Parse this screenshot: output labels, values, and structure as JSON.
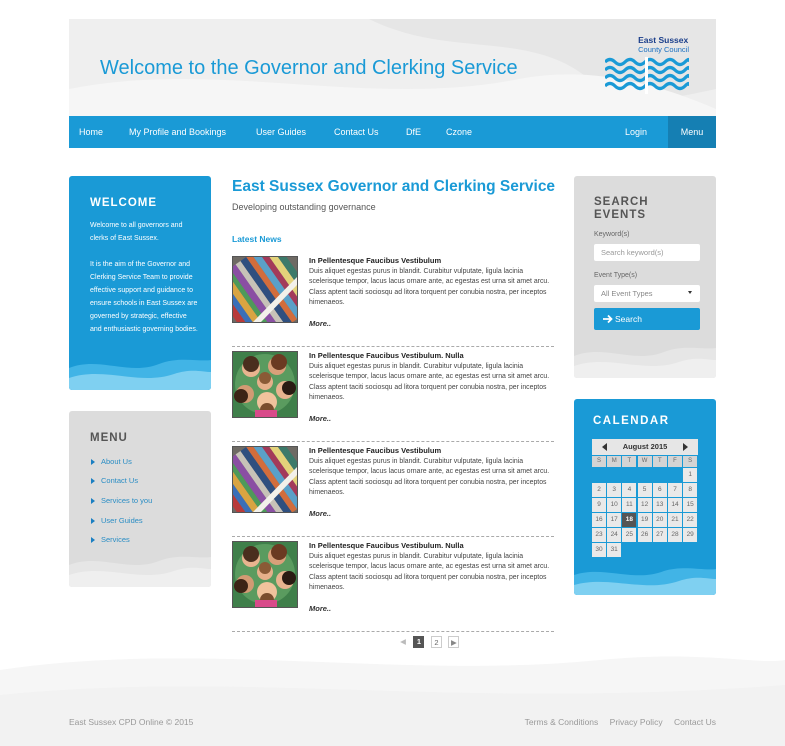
{
  "header": {
    "title": "Welcome to the Governor and Clerking Service",
    "logo_line1": "East Sussex",
    "logo_line2": "County Council"
  },
  "nav": {
    "items": [
      "Home",
      "My Profile and Bookings",
      "User Guides",
      "Contact Us",
      "DfE",
      "Czone"
    ],
    "login": "Login",
    "menu": "Menu"
  },
  "welcome": {
    "title": "WELCOME",
    "para1": "Welcome to all governors and clerks of East Sussex.",
    "para2": "It is the aim of the Governor and Clerking Service Team to provide effective support and guidance to ensure schools in East Sussex are governed by strategic, effective and enthusiastic governing bodies."
  },
  "menu": {
    "title": "MENU",
    "items": [
      "About Us",
      "Contact Us",
      "Services to you",
      "User Guides",
      "Services"
    ]
  },
  "main": {
    "title": "East Sussex Governor and Clerking Service",
    "subtitle": "Developing outstanding governance",
    "latest_label": "Latest News",
    "news": [
      {
        "title": "In Pellentesque Faucibus Vestibulum",
        "body": "Duis aliquet egestas purus in blandit. Curabitur vulputate, ligula lacinia scelerisque tempor, lacus lacus ornare ante, ac egestas est urna sit amet arcu. Class aptent taciti sociosqu ad litora torquent per conubia nostra, per inceptos himenaeos.",
        "more": "More..",
        "image": "books"
      },
      {
        "title": "In Pellentesque Faucibus Vestibulum. Nulla",
        "body": "Duis aliquet egestas purus in blandit. Curabitur vulputate, ligula lacinia scelerisque tempor, lacus lacus ornare ante, ac egestas est urna sit amet arcu. Class aptent taciti sociosqu ad litora torquent per conubia nostra, per inceptos himenaeos.",
        "more": "More..",
        "image": "people"
      },
      {
        "title": "In Pellentesque Faucibus Vestibulum",
        "body": "Duis aliquet egestas purus in blandit. Curabitur vulputate, ligula lacinia scelerisque tempor, lacus lacus ornare ante, ac egestas est urna sit amet arcu. Class aptent taciti sociosqu ad litora torquent per conubia nostra, per inceptos himenaeos.",
        "more": "More..",
        "image": "books"
      },
      {
        "title": "In Pellentesque Faucibus Vestibulum. Nulla",
        "body": "Duis aliquet egestas purus in blandit. Curabitur vulputate, ligula lacinia scelerisque tempor, lacus lacus ornare ante, ac egestas est urna sit amet arcu. Class aptent taciti sociosqu ad litora torquent per conubia nostra, per inceptos himenaeos.",
        "more": "More..",
        "image": "people"
      }
    ],
    "pager": {
      "prev": "◀",
      "current": "1",
      "next_page": "2",
      "next": "▶"
    }
  },
  "search": {
    "title": "SEARCH EVENTS",
    "keyword_label": "Keyword(s)",
    "keyword_placeholder": "Search keyword(s)",
    "type_label": "Event Type(s)",
    "type_value": "All Event Types",
    "button": "Search"
  },
  "calendar": {
    "title": "CALENDAR",
    "month": "August 2015",
    "dow": [
      "S",
      "M",
      "T",
      "W",
      "T",
      "F",
      "S"
    ],
    "days": [
      "1",
      "2",
      "3",
      "4",
      "5",
      "6",
      "7",
      "8",
      "9",
      "10",
      "11",
      "12",
      "13",
      "14",
      "15",
      "16",
      "17",
      "18",
      "19",
      "20",
      "21",
      "22",
      "23",
      "24",
      "25",
      "26",
      "27",
      "28",
      "29",
      "30",
      "31"
    ],
    "today": "18"
  },
  "footer": {
    "copyright": "East Sussex CPD Online © 2015",
    "links": [
      "Terms & Conditions",
      "Privacy Policy",
      "Contact Us"
    ]
  },
  "colors": {
    "accent": "#1a9ad6",
    "nav_dark": "#157fb3",
    "panel_grey": "#dcdcdc"
  }
}
